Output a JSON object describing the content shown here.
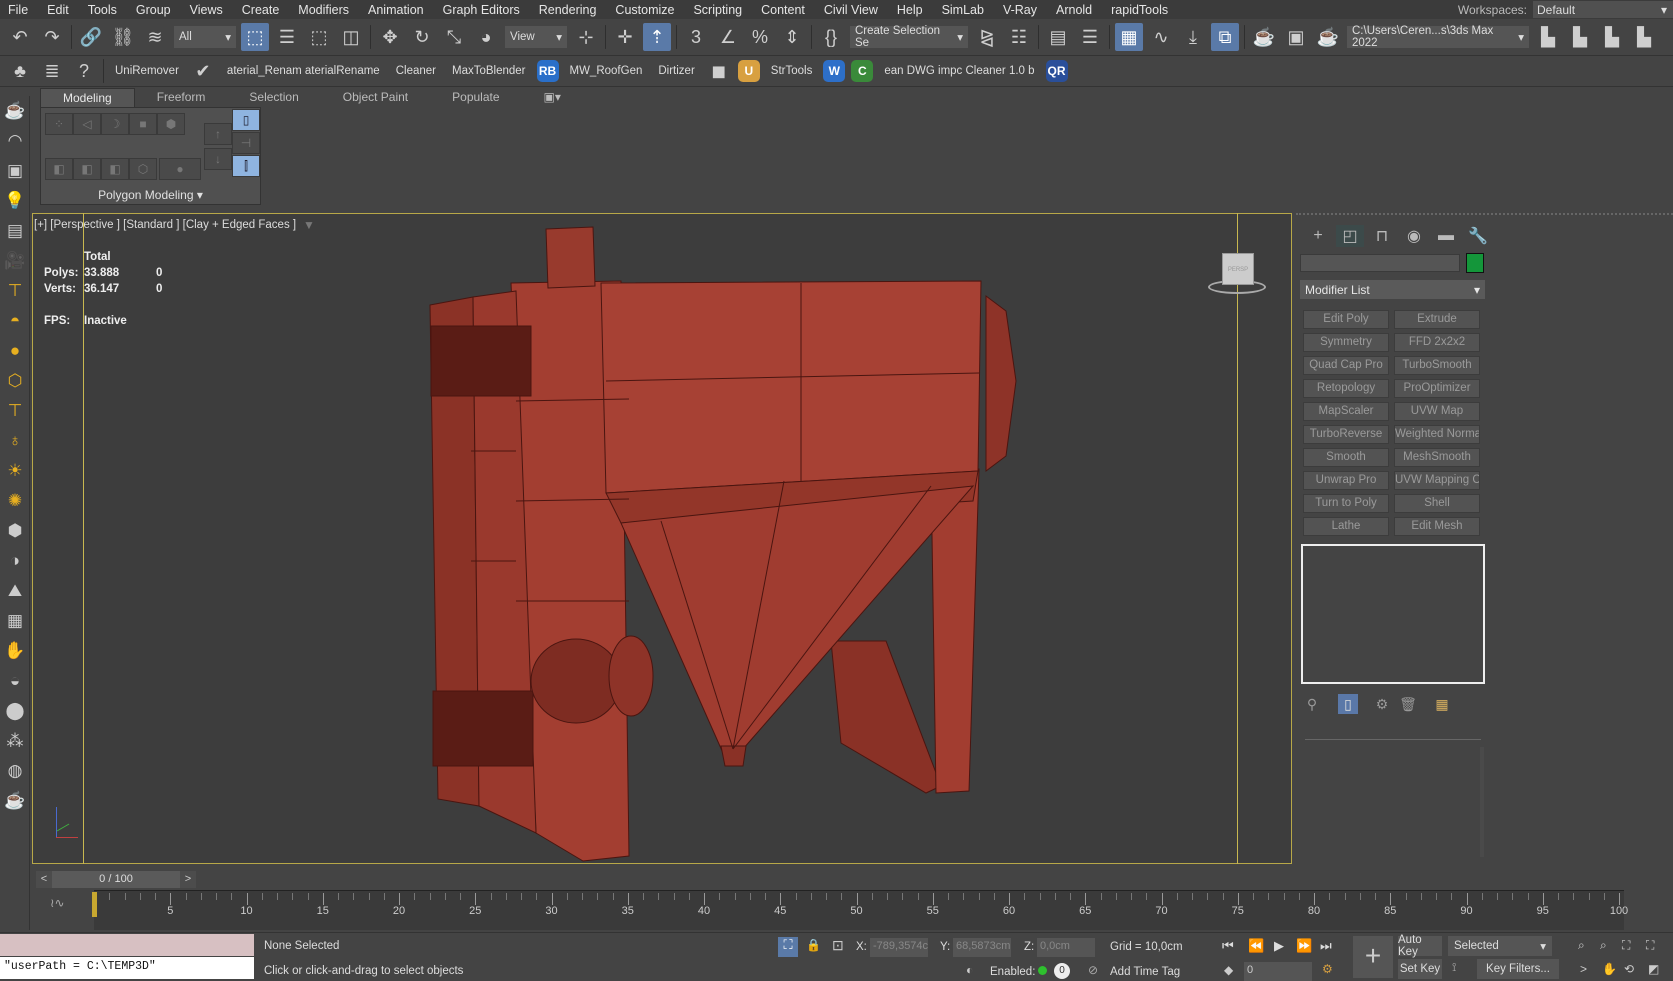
{
  "menu": [
    "File",
    "Edit",
    "Tools",
    "Group",
    "Views",
    "Create",
    "Modifiers",
    "Animation",
    "Graph Editors",
    "Rendering",
    "Customize",
    "Scripting",
    "Content",
    "Civil View",
    "Help",
    "SimLab",
    "V-Ray",
    "Arnold",
    "rapidTools"
  ],
  "workspaces": {
    "label": "Workspaces:",
    "value": "Default"
  },
  "toolbar1": [
    {
      "icon": "undo-icon"
    },
    {
      "icon": "redo-icon"
    },
    {
      "sep": true
    },
    {
      "icon": "link-icon"
    },
    {
      "icon": "unlink-icon"
    },
    {
      "icon": "bind-space-warp-icon"
    },
    {
      "dropdown": "All",
      "w": 62
    },
    {
      "icon": "select-object-icon",
      "active": true
    },
    {
      "icon": "select-by-name-icon"
    },
    {
      "icon": "rectangle-selection-icon"
    },
    {
      "icon": "window-crossing-icon"
    },
    {
      "sep": true
    },
    {
      "icon": "move-icon"
    },
    {
      "icon": "rotate-icon"
    },
    {
      "icon": "scale-icon"
    },
    {
      "icon": "placement-icon"
    },
    {
      "dropdown": "View",
      "w": 62
    },
    {
      "icon": "pivot-icon"
    },
    {
      "sep": true
    },
    {
      "icon": "manipulate-icon"
    },
    {
      "icon": "keyboard-override-icon",
      "active": true
    },
    {
      "sep": true
    },
    {
      "icon": "snap-3d-icon"
    },
    {
      "icon": "angle-snap-icon"
    },
    {
      "icon": "percent-snap-icon"
    },
    {
      "icon": "spinner-snap-icon"
    },
    {
      "sep": true
    },
    {
      "icon": "edit-named-selection-icon"
    },
    {
      "dropdown": "Create Selection Se",
      "w": 118
    },
    {
      "icon": "mirror-icon"
    },
    {
      "icon": "align-icon"
    },
    {
      "sep": true
    },
    {
      "icon": "scene-explorer-icon"
    },
    {
      "icon": "layer-explorer-icon"
    },
    {
      "sep": true
    },
    {
      "icon": "toggle-ribbon-icon",
      "active": true
    },
    {
      "icon": "curve-editor-icon"
    },
    {
      "icon": "dope-sheet-icon"
    },
    {
      "icon": "schematic-view-icon",
      "active": true
    },
    {
      "sep": true
    },
    {
      "icon": "render-setup-icon"
    },
    {
      "icon": "rendered-frame-icon"
    },
    {
      "icon": "render-icon"
    },
    {
      "dropdown": "C:\\Users\\Ceren...s\\3ds Max 2022",
      "w": 182
    },
    {
      "icon": "project-folder-icon"
    },
    {
      "icon": "open-project-icon"
    },
    {
      "icon": "project-structure-icon"
    },
    {
      "icon": "project-settings-icon"
    }
  ],
  "toolbar2": [
    {
      "icon": "tree-icon"
    },
    {
      "icon": "list-icon"
    },
    {
      "icon": "help-icon"
    },
    {
      "sep": true
    },
    {
      "label": "UniRemover"
    },
    {
      "icon": "material-rename-icon"
    },
    {
      "label": "aterial_Renam aterialRename"
    },
    {
      "label": "Cleaner"
    },
    {
      "label": "MaxToBlender"
    },
    {
      "badge": "RB",
      "color": "#2a6fc9"
    },
    {
      "label": "MW_RoofGen"
    },
    {
      "label": "Dirtizer"
    },
    {
      "icon": "paint-bucket-icon"
    },
    {
      "badge": "U",
      "color": "#d8a040"
    },
    {
      "label": "StrTools"
    },
    {
      "badge": "W",
      "color": "#2d6fc9"
    },
    {
      "badge": "C",
      "color": "#3a8a3a"
    },
    {
      "label": "ean DWG impc Cleaner 1.0 b"
    },
    {
      "badge": "QR",
      "color": "#2a4f9a"
    }
  ],
  "ribbon": {
    "tabs": [
      "Modeling",
      "Freeform",
      "Selection",
      "Object Paint",
      "Populate"
    ],
    "active": 0,
    "panel_title": "Polygon Modeling"
  },
  "left_icons": [
    "teapot-icon",
    "shapes-icon",
    "box-icon",
    "light-icon",
    "camera-list-icon",
    "camera-icon",
    "helper-icon",
    "dome-icon",
    "sphere-icon",
    "geosphere-icon",
    "spot-icon",
    "bulb-icon",
    "sun-icon",
    "sunburst-icon",
    "cube-icon",
    "material-icon",
    "terrain-icon",
    "pattern-icon",
    "hand-icon",
    "paint-icon",
    "ball-icon",
    "particles-icon",
    "drop-icon",
    "render-icon"
  ],
  "viewport": {
    "label": "[+] [Perspective ] [Standard ] [Clay + Edged Faces ]",
    "stats": {
      "header": "Total",
      "polys_label": "Polys:",
      "polys": "33.888",
      "polys_sel": "0",
      "verts_label": "Verts:",
      "verts": "36.147",
      "verts_sel": "0",
      "fps_label": "FPS:",
      "fps": "Inactive"
    },
    "viewcube_label": "PERSP"
  },
  "command_panel": {
    "tabs": [
      "create-icon",
      "modify-icon",
      "hierarchy-icon",
      "motion-icon",
      "display-icon",
      "utilities-icon"
    ],
    "object_color": "#14963a",
    "modifier_list": "Modifier List",
    "modifiers": [
      "Edit Poly",
      "Extrude",
      "Symmetry",
      "FFD 2x2x2",
      "Quad Cap Pro",
      "TurboSmooth",
      "Retopology",
      "ProOptimizer",
      "MapScaler",
      "UVW Map",
      "TurboReverse",
      "Weighted Normals",
      "Smooth",
      "MeshSmooth",
      "Unwrap Pro",
      "UVW Mapping Clea",
      "Turn to Poly",
      "Shell",
      "Lathe",
      "Edit Mesh"
    ]
  },
  "timeline": {
    "slider": "0 / 100",
    "prev": "<",
    "next": ">",
    "start": 0,
    "end": 100,
    "current": 0
  },
  "status": {
    "maxscript": "\"userPath = C:\\TEMP3D\"",
    "selection": "None Selected",
    "prompt": "Click or click-and-drag to select objects",
    "x_label": "X:",
    "x": "-789,3574c",
    "y_label": "Y:",
    "y": "68,5873cm",
    "z_label": "Z:",
    "z": "0,0cm",
    "grid": "Grid = 10,0cm",
    "enabled": "Enabled:",
    "add_time_tag": "Add Time Tag",
    "auto_key": "Auto Key",
    "set_key": "Set Key",
    "key_mode": "Selected",
    "key_filters": "Key Filters...",
    "frame": "0"
  }
}
